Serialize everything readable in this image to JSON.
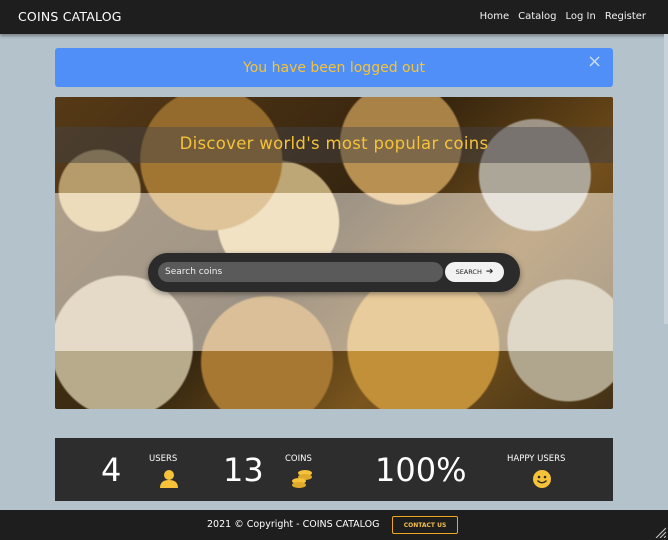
{
  "navbar": {
    "brand": "COINS CATALOG",
    "links": [
      "Home",
      "Catalog",
      "Log In",
      "Register"
    ]
  },
  "alert": {
    "message": "You have been logged out",
    "close_symbol": "×"
  },
  "hero": {
    "title": "Discover world's most popular coins",
    "search": {
      "placeholder": "Search coins",
      "button_label": "SEARCH"
    }
  },
  "stats": [
    {
      "value": "4",
      "label": "USERS",
      "icon": "user-icon"
    },
    {
      "value": "13",
      "label": "COINS",
      "icon": "coins-icon"
    },
    {
      "value": "100%",
      "label": "HAPPY USERS",
      "icon": "smile-icon"
    }
  ],
  "footer": {
    "copyright": "2021 © Copyright -  COINS CATALOG",
    "contact_label": "CONTACT US"
  },
  "colors": {
    "accent": "#f5c23a",
    "alert_bg": "#4f8ff7",
    "dark": "#1e1e1e",
    "page_bg": "#b3c2cb"
  }
}
